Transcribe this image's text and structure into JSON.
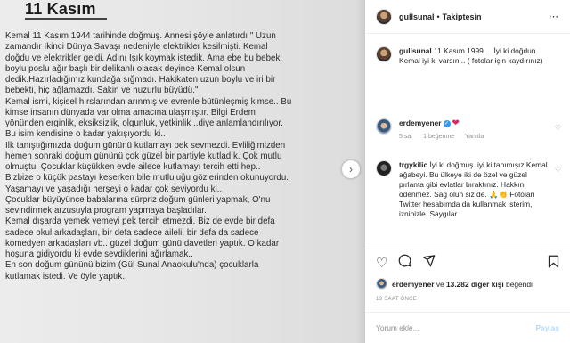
{
  "photo": {
    "title": "11 Kasım",
    "lines": [
      "Kemal 11 Kasım 1944 tarihinde doğmuş. Annesi şöyle anlatırdı \" Uzun",
      "zamandır İkinci Dünya Savaşı nedeniyle elektrikler kesilmişti. Kemal",
      "doğdu ve elektrikler geldi. Adını Işık koymak istedik. Ama ebe bu bebek",
      "boylu poslu ağır başlı bir delikanlı olacak deyince Kemal olsun",
      "dedik.Hazırladığımız kundağa sığmadı. Hakikaten uzun boylu ve iri bir",
      "bebekti, hiç ağlamazdı. Sakin ve huzurlu büyüdü.\"",
      "Kemal ismi, kişisel hırslarından arınmış ve evrenle bütünleşmiş kimse.. Bu",
      "kimse insanın dünyada var olma amacına ulaşmıştır. Bilgi Erdem",
      "yönünden erginlik, eksiksizlik, olgunluk, yetkinlik ..diye anlamlandırılıyor.",
      "Bu isim kendisine o kadar yakışıyordu ki..",
      "İlk tanıştığımızda doğum gününü kutlamayı pek sevmezdi. Evliliğimizden",
      "hemen sonraki doğum gününü çok güzel bir partiyle kutladık. Çok mutlu",
      "olmuştu. Çocuklar küçükken evde ailece kutlamayı tercih etti hep..",
      "Bizbize o küçük pastayı keserken bile mutluluğu gözlerinden okunuyordu.",
      "Yaşamayı ve yaşadığı herşeyi o kadar çok seviyordu ki..",
      "Çocuklar büyüyünce babalarına sürpriz doğum günleri yapmak, O'nu",
      "sevindirmek arzusuyla program yapmaya başladılar.",
      "Kemal dışarda yemek yemeyi pek tercih etmezdi. Biz de evde bir defa",
      "sadece okul arkadaşları, bir defa sadece aileli, bir defa da sadece",
      "komedyen arkadaşları vb.. güzel doğum günü davetleri yaptık. O kadar",
      "hoşuna gidiyordu ki evde sevdiklerini ağırlamak..",
      "En son doğum gününü bizim (Gül Sunal Anaokulu'nda) çocuklarla",
      "kutlamak istedi. Ve öyle yaptık.."
    ],
    "next_arrow": "›"
  },
  "header": {
    "username": "gullsunal",
    "separator": "•",
    "follow_label": "Takiptesin",
    "more_icon": "⋯"
  },
  "caption": {
    "username": "gullsunal",
    "text": "11 Kasım 1999.... İyi ki doğdun Kemal iyi ki varsın... ( fotolar için kaydırınız)"
  },
  "comments": [
    {
      "username": "erdemyener",
      "text": "",
      "time": "5 sa.",
      "likes": "1 beğenme",
      "reply": "Yanıtla"
    },
    {
      "username": "trgykilic",
      "text": "İyi ki doğmuş. iyi ki tanımışız Kemal ağabeyi. Bu ülkeye iki de özel ve güzel pırlanta gibi evlatlar bıraktınız. Hakkını ödenmez. Sağ olun siz de. 🙏👏 Fotoları Twitter hesabımda da kullanmak isterim, izninizle. Saygılar"
    }
  ],
  "likes": {
    "user": "erdemyener",
    "connector": " ve ",
    "others": "13.282 diğer kişi",
    "suffix": " beğendi"
  },
  "timestamp": "13 SAAT ÖNCE",
  "comment_box": {
    "placeholder": "Yorum ekle...",
    "post_label": "Paylaş"
  },
  "colors": {
    "verified": "#3897f0",
    "heart": "#e0245e",
    "post_disabled": "#b3dbff",
    "muted": "#8e8e8e"
  },
  "icons": {
    "like": "heart-icon",
    "comment": "comment-icon",
    "share": "share-icon",
    "save": "bookmark-icon"
  }
}
